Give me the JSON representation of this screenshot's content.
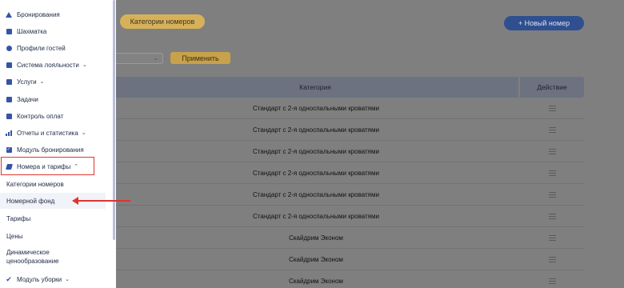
{
  "header": {
    "category_pill": "Категории номеров",
    "new_button": "+ Новый номер"
  },
  "filters": {
    "apply_label": "Применить",
    "select_value": ""
  },
  "table": {
    "headers": {
      "category": "Категория",
      "action": "Действие"
    },
    "rows": [
      "Стандарт с 2-я односпальными кроватями",
      "Стандарт с 2-я односпальными кроватями",
      "Стандарт с 2-я односпальными кроватями",
      "Стандарт с 2-я односпальными кроватями",
      "Стандарт с 2-я односпальными кроватями",
      "Стандарт с 2-я односпальными кроватями",
      "Скайдрим Эконом",
      "Скайдрим Эконом",
      "Скайдрим Эконом"
    ]
  },
  "sidebar": {
    "items": [
      {
        "label": "Бронирования",
        "icon": "home-icon"
      },
      {
        "label": "Шахматка",
        "icon": "calendar-icon"
      },
      {
        "label": "Профили гостей",
        "icon": "user-icon"
      },
      {
        "label": "Система лояльности",
        "icon": "loyalty-icon",
        "chevron": "⌄"
      },
      {
        "label": "Услуги",
        "icon": "tag-icon",
        "chevron": "⌄"
      },
      {
        "label": "Задачи",
        "icon": "task-icon"
      },
      {
        "label": "Контроль оплат",
        "icon": "payment-icon"
      },
      {
        "label": "Отчеты и статистика",
        "icon": "chart-icon",
        "chevron": "⌄"
      },
      {
        "label": "Модуль бронирования",
        "icon": "booking-module-icon"
      },
      {
        "label": "Номера и тарифы",
        "icon": "rooms-icon",
        "chevron": "⌃"
      }
    ],
    "subitems": [
      {
        "label": "Категории номеров"
      },
      {
        "label": "Номерной фонд"
      },
      {
        "label": "Тарифы"
      },
      {
        "label": "Цены"
      },
      {
        "label": "Динамическое ценообразование"
      }
    ],
    "bottom_item": {
      "label": "Модуль уборки",
      "icon": "cleaning-icon",
      "chevron": "⌄"
    }
  },
  "colors": {
    "accent": "#3553a8",
    "highlight": "#e0342f",
    "pill": "#d7b15a",
    "primary_button": "#2f4f8f"
  }
}
